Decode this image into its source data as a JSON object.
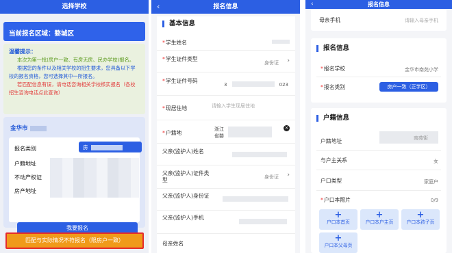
{
  "panel1": {
    "title": "选择学校",
    "region_label": "当前报名区域：婺城区",
    "tips": {
      "title": "温馨提示：",
      "p1": "本次为第一批(房户一致、有房无房、民办学校)报名。",
      "p2": "根据您的条件以及相关学校的招生要求，您具备以下学校的报名资格，您可选择其中一所报名。",
      "p3": "若匹配信息有误，请电话咨询相关学校核实报名（各校招生咨询电话点此查询）"
    },
    "school": {
      "name": "金华市",
      "type_label": "报名类别",
      "type_value": "房",
      "rows": [
        "户籍地址",
        "不动产权证",
        "房产地址"
      ],
      "apply_label": "我要报名"
    },
    "mismatch_label": "匹配与实际情况不符报名（限房户一致）"
  },
  "panel2": {
    "title": "报名信息",
    "section": "基本信息",
    "fields": [
      {
        "label": "学生姓名",
        "required": true,
        "value": ""
      },
      {
        "label": "学生证件类型",
        "required": true,
        "value": "身份证"
      },
      {
        "label": "学生证件号码",
        "required": true,
        "value_left": "3",
        "value_right": "023"
      },
      {
        "label": "现居住地",
        "required": true,
        "value": "请输入学生现居住地"
      },
      {
        "label": "户籍地",
        "required": true,
        "value_left": "浙江",
        "value_left2": "省婺"
      },
      {
        "label": "父亲(监护人)姓名",
        "required": false,
        "value": ""
      },
      {
        "label": "父亲(监护人)证件类型",
        "required": false,
        "value": "身份证"
      },
      {
        "label": "父亲(监护人)身份证",
        "required": false,
        "value": ""
      },
      {
        "label": "父亲(监护人)手机",
        "required": false,
        "value": ""
      },
      {
        "label": "母亲姓名",
        "required": false,
        "value": ""
      }
    ]
  },
  "panel3": {
    "title": "报名信息",
    "mother_phone_label": "母亲手机",
    "mother_phone_placeholder": "请输入母亲手机",
    "enroll_section": "报名信息",
    "school_label": "报名学校",
    "school_value": "金华市南苑小学",
    "type_label": "报名类别",
    "type_value": "房户一致（正学区）",
    "hukou_section": "户籍信息",
    "hukou_address_label": "户籍地址",
    "hukou_address_value": "南苑街",
    "relation_label": "与户主关系",
    "relation_value": "女",
    "type2_label": "户口类型",
    "type2_value": "家庭户",
    "photo_label": "户口本照片",
    "photo_count": "0/9",
    "tiles": [
      "户口本首页",
      "户口本户主页",
      "户口本孩子页",
      "户口本父母页"
    ]
  }
}
